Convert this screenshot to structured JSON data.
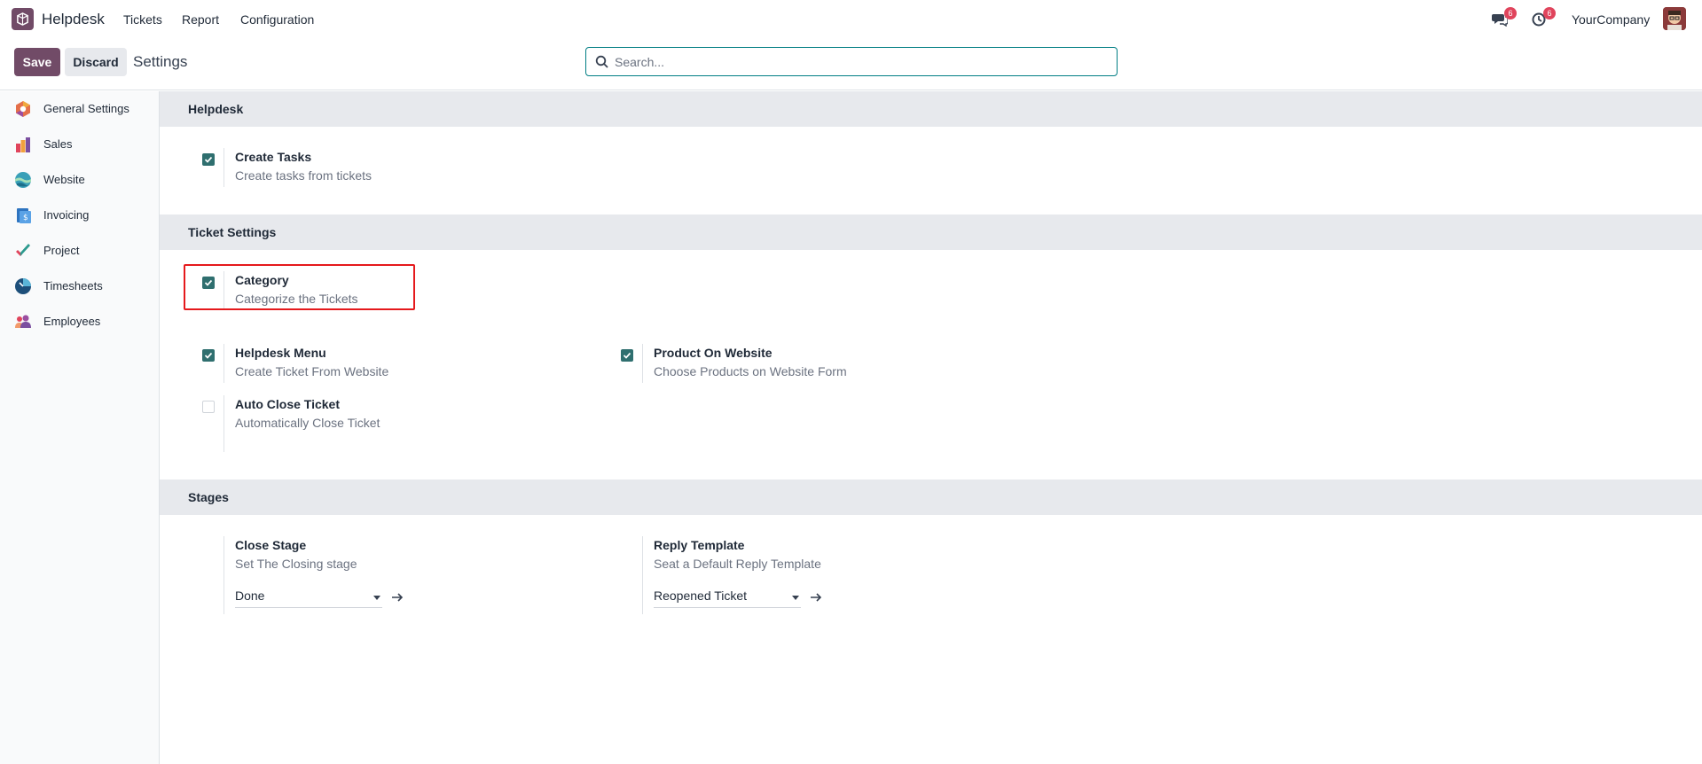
{
  "nav": {
    "app_name": "Helpdesk",
    "menu": [
      "Tickets",
      "Report",
      "Configuration"
    ],
    "messages_badge": "6",
    "activities_badge": "6",
    "company": "YourCompany"
  },
  "control": {
    "save_label": "Save",
    "discard_label": "Discard",
    "breadcrumb": "Settings",
    "search_placeholder": "Search..."
  },
  "sidebar": {
    "items": [
      {
        "label": "General Settings",
        "icon": "general-settings-icon"
      },
      {
        "label": "Sales",
        "icon": "sales-icon"
      },
      {
        "label": "Website",
        "icon": "website-icon"
      },
      {
        "label": "Invoicing",
        "icon": "invoicing-icon"
      },
      {
        "label": "Project",
        "icon": "project-icon"
      },
      {
        "label": "Timesheets",
        "icon": "timesheets-icon"
      },
      {
        "label": "Employees",
        "icon": "employees-icon"
      }
    ]
  },
  "sections": {
    "helpdesk": {
      "title": "Helpdesk",
      "create_tasks": {
        "title": "Create Tasks",
        "desc": "Create tasks from tickets",
        "checked": true
      }
    },
    "ticket_settings": {
      "title": "Ticket Settings",
      "category": {
        "title": "Category",
        "desc": "Categorize the Tickets",
        "checked": true
      },
      "helpdesk_menu": {
        "title": "Helpdesk Menu",
        "desc": "Create Ticket From Website",
        "checked": true
      },
      "product_on_website": {
        "title": "Product On Website",
        "desc": "Choose Products on Website Form",
        "checked": true
      },
      "auto_close": {
        "title": "Auto Close Ticket",
        "desc": "Automatically Close Ticket",
        "checked": false
      }
    },
    "stages": {
      "title": "Stages",
      "close_stage": {
        "title": "Close Stage",
        "desc": "Set The Closing stage",
        "value": "Done"
      },
      "reply_template": {
        "title": "Reply Template",
        "desc": "Seat a Default Reply Template",
        "value": "Reopened Ticket"
      }
    }
  },
  "colors": {
    "brand": "#714b67",
    "checkbox": "#2f6f6f",
    "highlight": "#e5191c",
    "badge": "#e0445c"
  }
}
